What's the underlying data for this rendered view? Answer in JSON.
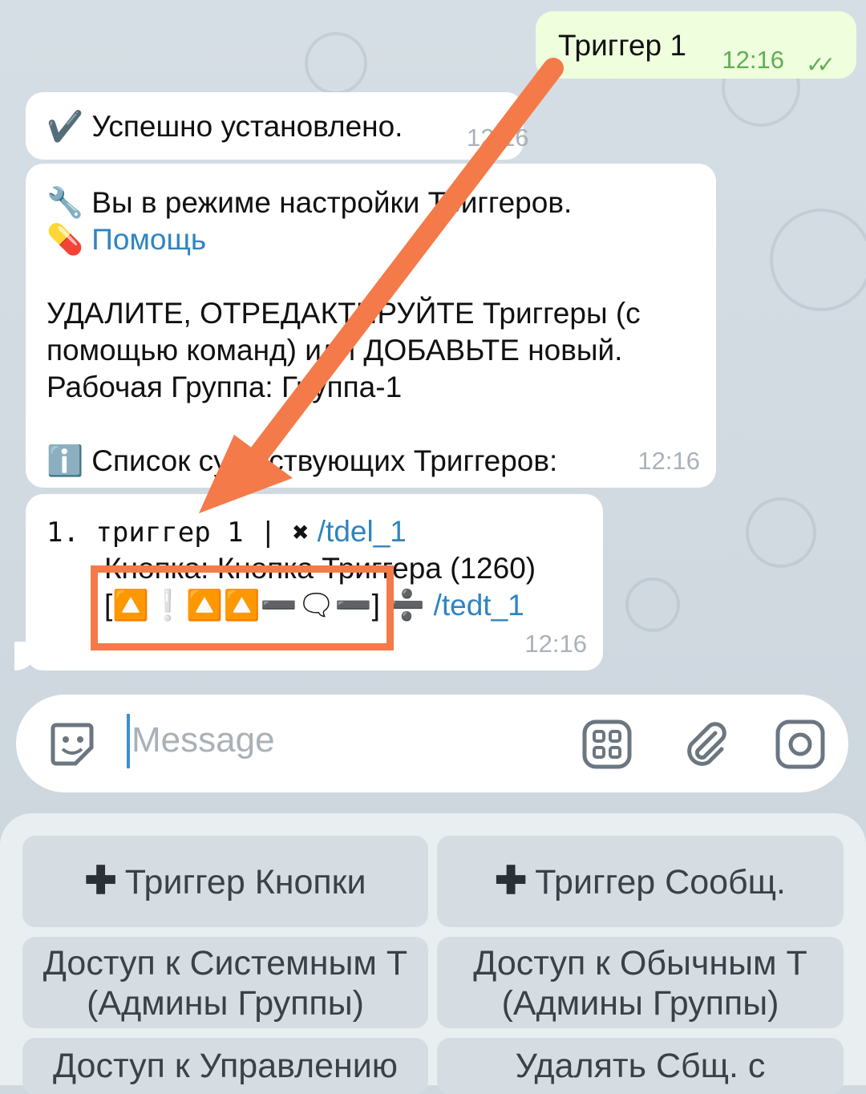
{
  "chat": {
    "outgoing": {
      "text": "Триггер 1",
      "time": "12:16",
      "status_icon": "double-check-icon"
    },
    "messages": [
      {
        "emoji": "✔️",
        "text": "Успешно установлено.",
        "time": "12:16"
      },
      {
        "line1_emoji": "🔧",
        "line1_text": "Вы в режиме настройки Триггеров.",
        "line2_emoji": "💊",
        "help_link": "Помощь",
        "para_line1": "УДАЛИТЕ, ОТРЕДАКТИРУЙТЕ Триггеры (с",
        "para_line2": "помощью команд) или ДОБАВЬТЕ новый.",
        "para_line3": "Рабочая Группа: Группа-1",
        "list_emoji": "ℹ️",
        "list_text": "Список существующих Триггеров:",
        "time": "12:16"
      },
      {
        "item_prefix": "1. триггер 1 | ✖",
        "delete_command": "/tdel_1",
        "button_line": "Кнопка: Кнопка Триггера (1260)",
        "icons_line": "[🔼❕🔼🔼➖🗨➖]",
        "divide_symbol": "➗",
        "edit_command": "/tedt_1",
        "time": "12:16"
      }
    ]
  },
  "input": {
    "placeholder": "Message",
    "left_icon": "sticker-icon",
    "right_icons": [
      "bot-menu-icon",
      "attach-icon",
      "camera-icon"
    ]
  },
  "keyboard": {
    "buttons": [
      {
        "icon": "plus-icon",
        "label": "Триггер Кнопки"
      },
      {
        "icon": "plus-icon",
        "label": "Триггер Сообщ."
      },
      {
        "line1": "Доступ к Системным Т",
        "line2": "(Админы Группы)"
      },
      {
        "line1": "Доступ к Обычным Т",
        "line2": "(Админы Группы)"
      },
      {
        "line1": "Доступ к Управлению"
      },
      {
        "line1": "Удалять Сбщ. с"
      }
    ]
  },
  "annotation": {
    "color": "#f47a4a"
  }
}
